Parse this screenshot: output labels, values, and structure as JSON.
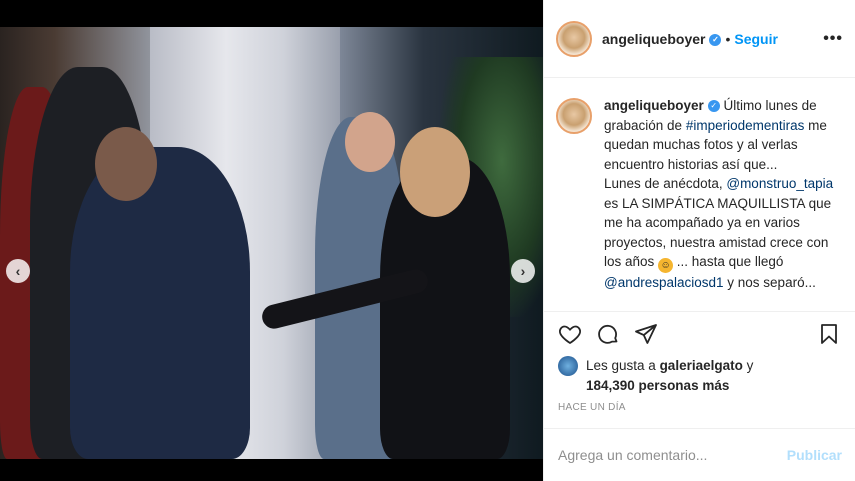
{
  "post": {
    "username": "angeliqueboyer",
    "follow_label": "Seguir",
    "separator": "•",
    "more_label": "•••"
  },
  "caption": {
    "username": "angeliqueboyer",
    "part1": "Último lunes de grabación de ",
    "hashtag": "#imperiodementiras",
    "part2": " me quedan muchas fotos y al verlas encuentro historias así que...",
    "part3": "Lunes de anécdota, ",
    "mention1": "@monstruo_tapia",
    "part4": " es LA SIMPÁTICA MAQUILLISTA que me ha acompañado ya en varios proyectos, nuestra amistad crece con los años ",
    "part5": " ... hasta que llegó ",
    "mention2": "@andrespalaciosd1",
    "part6": " y nos separó..."
  },
  "likes": {
    "prefix": "Les gusta a ",
    "user": "galeriaelgato",
    "middle": " y",
    "count": "184,390 personas más"
  },
  "timestamp": "HACE UN DÍA",
  "comment": {
    "placeholder": "Agrega un comentario...",
    "publish_label": "Publicar"
  },
  "carousel": {
    "prev_icon": "chevron-left-icon",
    "next_icon": "chevron-right-icon",
    "prev_glyph": "‹",
    "next_glyph": "›",
    "dots": [
      false,
      false,
      false,
      true,
      false,
      false
    ]
  },
  "colors": {
    "link": "#00376b",
    "accent": "#0095f6",
    "verified": "#3897f0"
  }
}
